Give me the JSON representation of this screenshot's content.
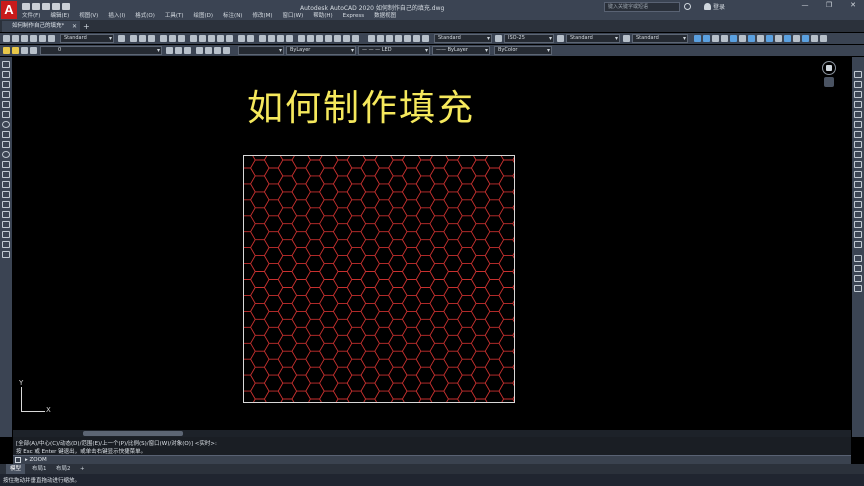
{
  "window": {
    "title": "Autodesk AutoCAD 2020    如何制作自己的填充.dwg",
    "search_placeholder": "键入关键字或短语",
    "login_label": "登录",
    "controls": [
      "—",
      "❐",
      "✕"
    ]
  },
  "menus": [
    "文件(F)",
    "编辑(E)",
    "视图(V)",
    "插入(I)",
    "格式(O)",
    "工具(T)",
    "绘图(D)",
    "标注(N)",
    "修改(M)",
    "窗口(W)",
    "帮助(H)",
    "Express",
    "数据视图"
  ],
  "tabs": {
    "active": "如何制作自己的填充*",
    "close": "✕",
    "add": "+"
  },
  "toolbar1": {
    "text_style": "Standard",
    "dim_style": "ISO-25",
    "table_style": "Standard",
    "multileader_style": "Standard",
    "annotation_style": "Standard"
  },
  "toolbar2": {
    "layer": "0",
    "color": "ByLayer",
    "linetype": "— — — LED",
    "lineweight": "—— ByLayer",
    "plot_style": "ByColor"
  },
  "drawing": {
    "title": "如何制作填充",
    "hatch_color": "#c8312f",
    "ucs_x": "X",
    "ucs_y": "Y"
  },
  "command": {
    "history": [
      "[全部(A)/中心(C)/动态(D)/范围(E)/上一个(P)/比例(S)/窗口(W)/对象(O)] <实时>:",
      "按 Esc 或 Enter 键退出，或单击右键显示快捷菜单。"
    ],
    "current": "ZOOM"
  },
  "layout_tabs": [
    "模型",
    "布局1",
    "布局2",
    "+"
  ],
  "status": {
    "text": "按住拖动并垂直拖动进行缩放。"
  }
}
